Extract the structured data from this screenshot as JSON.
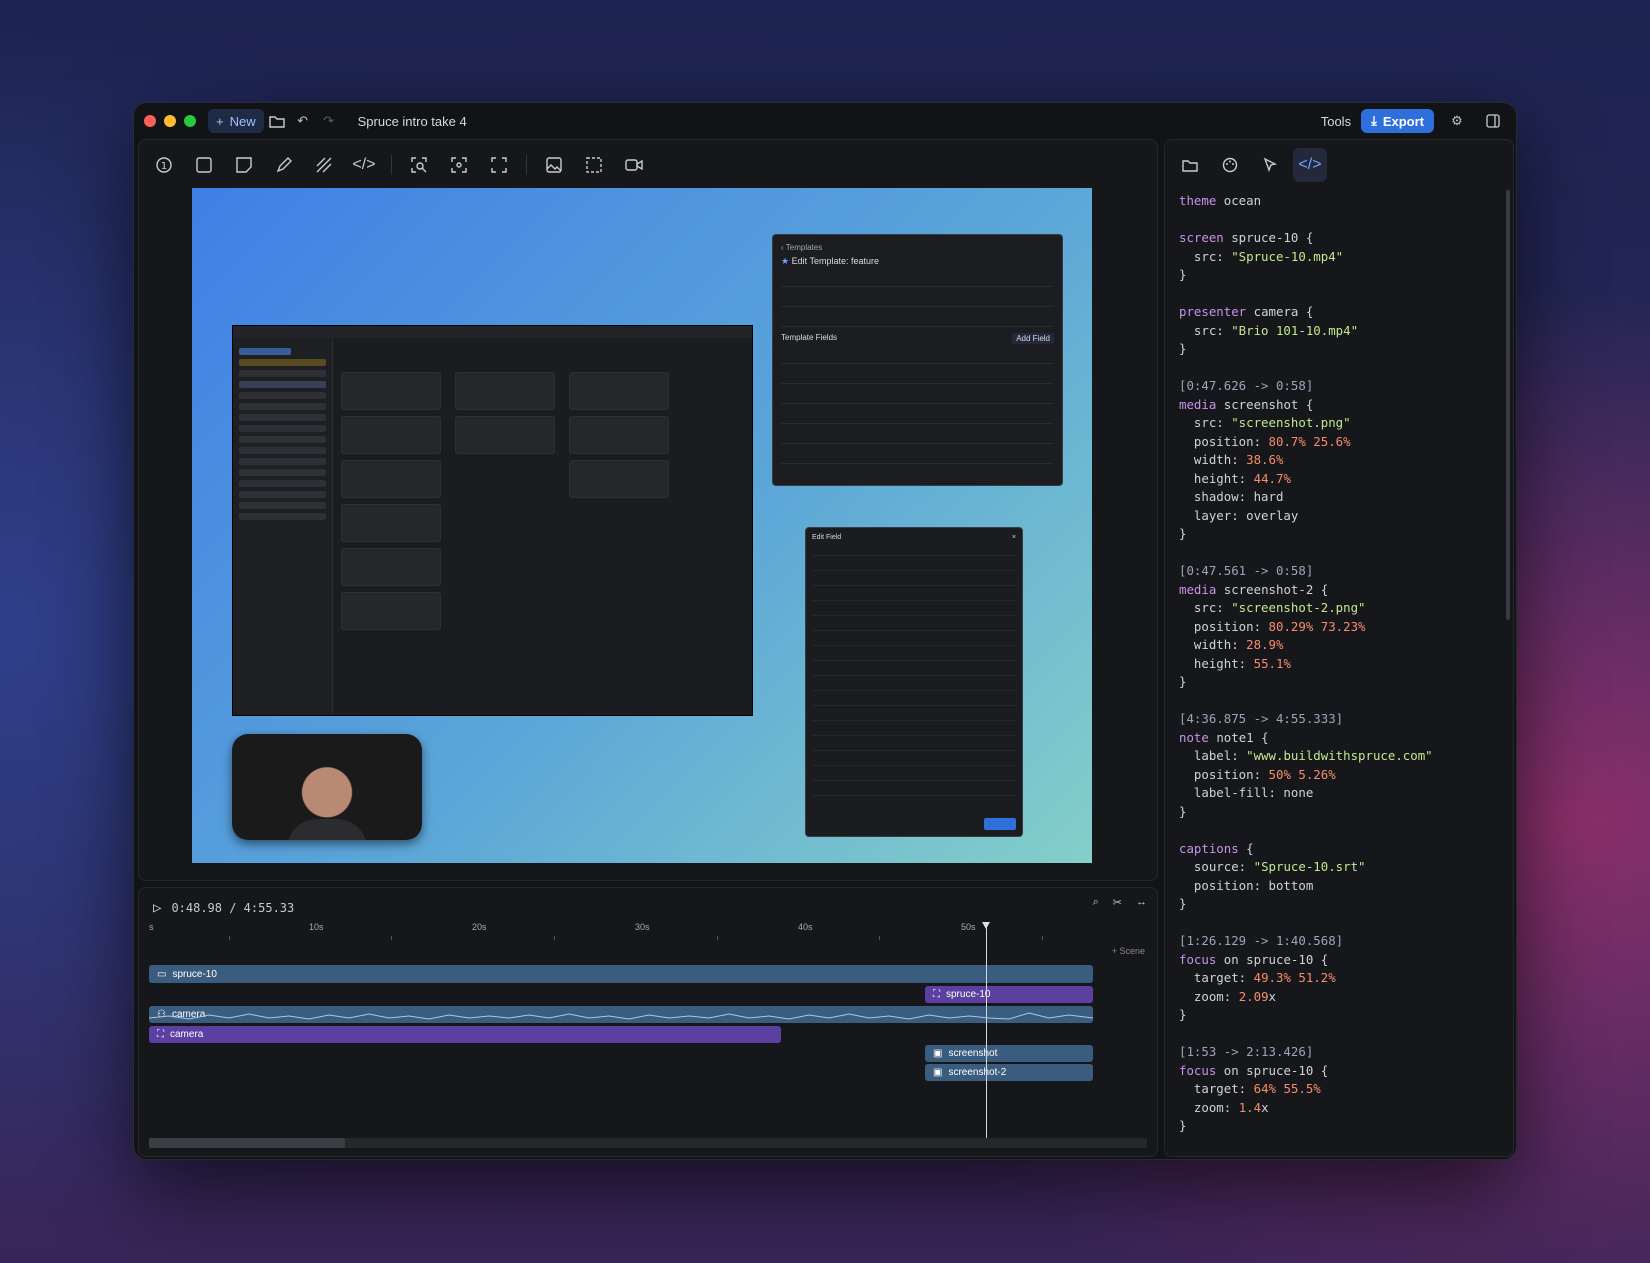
{
  "titlebar": {
    "new_label": "New",
    "project_title": "Spruce intro take 4",
    "tools_label": "Tools",
    "export_label": "Export"
  },
  "toolbar": {
    "tools": [
      "number-icon",
      "rectangle-icon",
      "sticky-note-icon",
      "pen-icon",
      "hatch-icon",
      "code-icon",
      "zoom-region-icon",
      "focus-icon",
      "fullscreen-icon",
      "image-icon",
      "selection-icon",
      "video-icon"
    ]
  },
  "canvas": {
    "template_back": "Templates",
    "template_title": "Edit Template: feature",
    "template_fields_label": "Template Fields",
    "add_field_label": "Add Field",
    "edit_field_title": "Edit Field"
  },
  "timeline": {
    "current_time": "0:48.98 / 4:55.33",
    "ruler": [
      "s",
      "10s",
      "20s",
      "30s",
      "40s",
      "50s"
    ],
    "add_scene": "+ Scene",
    "tracks": {
      "screen": "spruce-10",
      "screen_focus": "spruce-10",
      "camera": "camera",
      "camera_focus": "camera",
      "media1": "screenshot",
      "media2": "screenshot-2"
    },
    "playhead_time_seconds": 48.98
  },
  "code_panel": {
    "tabs": [
      "folder-icon",
      "palette-icon",
      "cursor-icon",
      "code-icon"
    ],
    "active_tab": "code-icon"
  },
  "code": [
    [
      [
        "kw",
        "theme"
      ],
      [
        "",
        "ocean"
      ]
    ],
    [],
    [
      [
        "kw",
        "screen"
      ],
      [
        "",
        "spruce-10 {"
      ]
    ],
    [
      [
        "",
        "  src: "
      ],
      [
        "str",
        "\"Spruce-10.mp4\""
      ]
    ],
    [
      [
        "",
        "}"
      ]
    ],
    [],
    [
      [
        "kw",
        "presenter"
      ],
      [
        "",
        "camera {"
      ]
    ],
    [
      [
        "",
        "  src: "
      ],
      [
        "str",
        "\"Brio 101-10.mp4\""
      ]
    ],
    [
      [
        "",
        "}"
      ]
    ],
    [],
    [
      [
        "ts",
        "[0:47.626 -> 0:58]"
      ]
    ],
    [
      [
        "kw",
        "media"
      ],
      [
        "",
        "screenshot {"
      ]
    ],
    [
      [
        "",
        "  src: "
      ],
      [
        "str",
        "\"screenshot.png\""
      ]
    ],
    [
      [
        "",
        "  position: "
      ],
      [
        "num",
        "80.7% 25.6%"
      ]
    ],
    [
      [
        "",
        "  width: "
      ],
      [
        "num",
        "38.6%"
      ]
    ],
    [
      [
        "",
        "  height: "
      ],
      [
        "num",
        "44.7%"
      ]
    ],
    [
      [
        "",
        "  shadow: hard"
      ]
    ],
    [
      [
        "",
        "  layer: overlay"
      ]
    ],
    [
      [
        "",
        "}"
      ]
    ],
    [],
    [
      [
        "ts",
        "[0:47.561 -> 0:58]"
      ]
    ],
    [
      [
        "kw",
        "media"
      ],
      [
        "",
        "screenshot-2 {"
      ]
    ],
    [
      [
        "",
        "  src: "
      ],
      [
        "str",
        "\"screenshot-2.png\""
      ]
    ],
    [
      [
        "",
        "  position: "
      ],
      [
        "num",
        "80.29% 73.23%"
      ]
    ],
    [
      [
        "",
        "  width: "
      ],
      [
        "num",
        "28.9%"
      ]
    ],
    [
      [
        "",
        "  height: "
      ],
      [
        "num",
        "55.1%"
      ]
    ],
    [
      [
        "",
        "}"
      ]
    ],
    [],
    [
      [
        "ts",
        "[4:36.875 -> 4:55.333]"
      ]
    ],
    [
      [
        "kw",
        "note"
      ],
      [
        "",
        "note1 {"
      ]
    ],
    [
      [
        "",
        "  label: "
      ],
      [
        "str",
        "\"www.buildwithspruce.com\""
      ]
    ],
    [
      [
        "",
        "  position: "
      ],
      [
        "num",
        "50% 5.26%"
      ]
    ],
    [
      [
        "",
        "  label-fill: none"
      ]
    ],
    [
      [
        "",
        "}"
      ]
    ],
    [],
    [
      [
        "kw",
        "captions"
      ],
      [
        "",
        "{"
      ]
    ],
    [
      [
        "",
        "  source: "
      ],
      [
        "str",
        "\"Spruce-10.srt\""
      ]
    ],
    [
      [
        "",
        "  position: bottom"
      ]
    ],
    [
      [
        "",
        "}"
      ]
    ],
    [],
    [
      [
        "ts",
        "[1:26.129 -> 1:40.568]"
      ]
    ],
    [
      [
        "kw",
        "focus"
      ],
      [
        "",
        "on spruce-10 {"
      ]
    ],
    [
      [
        "",
        "  target: "
      ],
      [
        "num",
        "49.3% 51.2%"
      ]
    ],
    [
      [
        "",
        "  zoom: "
      ],
      [
        "num",
        "2.09"
      ],
      [
        "",
        "x"
      ]
    ],
    [
      [
        "",
        "}"
      ]
    ],
    [],
    [
      [
        "ts",
        "[1:53 -> 2:13.426]"
      ]
    ],
    [
      [
        "kw",
        "focus"
      ],
      [
        "",
        "on spruce-10 {"
      ]
    ],
    [
      [
        "",
        "  target: "
      ],
      [
        "num",
        "64% 55.5%"
      ]
    ],
    [
      [
        "",
        "  zoom: "
      ],
      [
        "num",
        "1.4"
      ],
      [
        "",
        "x"
      ]
    ],
    [
      [
        "",
        "}"
      ]
    ]
  ]
}
